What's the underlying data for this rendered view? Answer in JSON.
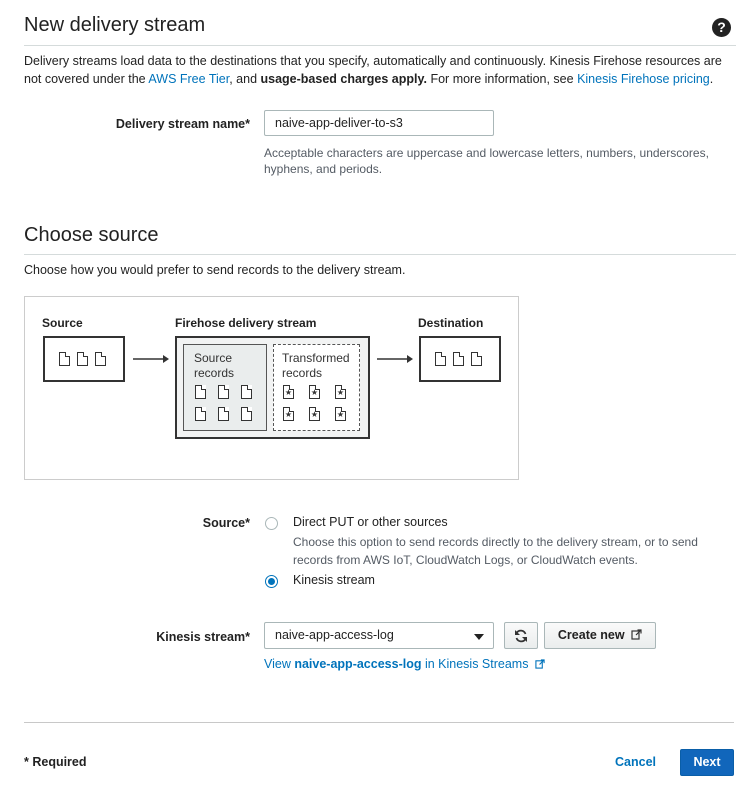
{
  "header": {
    "title": "New delivery stream",
    "help_icon": "?",
    "desc_part1": "Delivery streams load data to the destinations that you specify, automatically and continuously. Kinesis Firehose resources are not covered under the ",
    "free_tier_link": "AWS Free Tier",
    "desc_part2": ", and ",
    "usage_bold": "usage-based charges apply.",
    "desc_part3": " For more information, see ",
    "pricing_link": "Kinesis Firehose pricing",
    "desc_part4": "."
  },
  "stream_name": {
    "label": "Delivery stream name*",
    "value": "naive-app-deliver-to-s3",
    "hint": "Acceptable characters are uppercase and lowercase letters, numbers, underscores, hyphens, and periods."
  },
  "choose_source": {
    "title": "Choose source",
    "desc": "Choose how you would prefer to send records to the delivery stream."
  },
  "diagram": {
    "source_label": "Source",
    "firehose_label": "Firehose delivery stream",
    "destination_label": "Destination",
    "source_records_label": "Source records",
    "transformed_records_label": "Transformed records"
  },
  "source_option": {
    "label": "Source*",
    "option1": "Direct PUT or other sources",
    "option1_hint": "Choose this option to send records directly to the delivery stream, or to send records from AWS IoT, CloudWatch Logs, or CloudWatch events.",
    "option2": "Kinesis stream",
    "selected": "Kinesis stream"
  },
  "kinesis_stream": {
    "label": "Kinesis stream*",
    "value": "naive-app-access-log",
    "refresh_icon": "refresh-icon",
    "create_new_label": "Create new",
    "view_prefix": "View ",
    "view_stream": "naive-app-access-log",
    "view_suffix": " in Kinesis Streams"
  },
  "footer": {
    "required": "* Required",
    "cancel": "Cancel",
    "next": "Next"
  },
  "colors": {
    "link": "#0073bb",
    "primary_button": "#1166bb"
  }
}
